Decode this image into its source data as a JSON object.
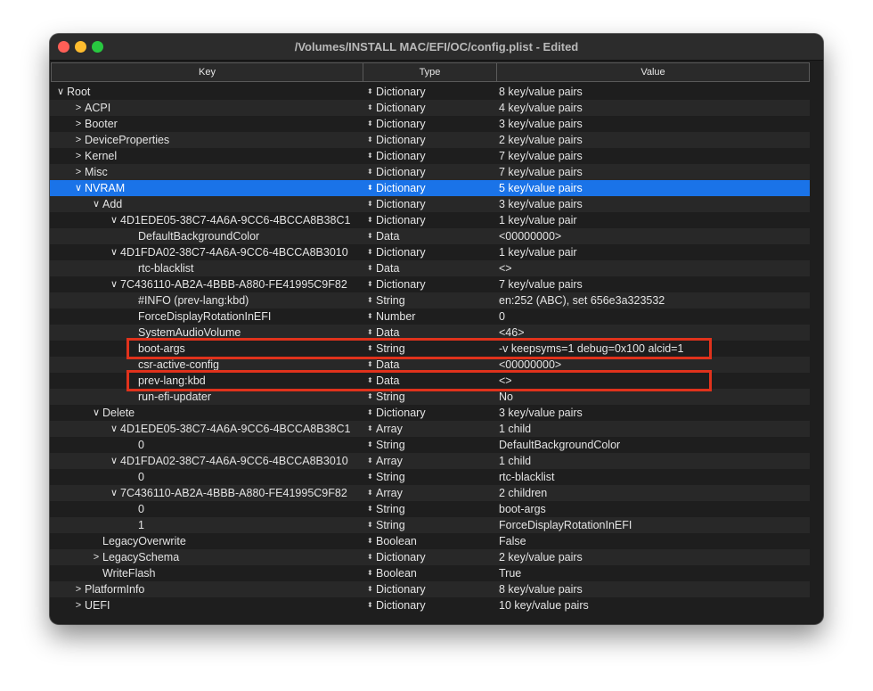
{
  "window": {
    "title": "/Volumes/INSTALL MAC/EFI/OC/config.plist - Edited"
  },
  "header": {
    "key": "Key",
    "type": "Type",
    "value": "Value"
  },
  "rows": [
    {
      "indent": 0,
      "disclosure": "open",
      "key": "Root",
      "type": "Dictionary",
      "value": "8 key/value pairs"
    },
    {
      "indent": 1,
      "disclosure": "closed",
      "key": "ACPI",
      "type": "Dictionary",
      "value": "4 key/value pairs"
    },
    {
      "indent": 1,
      "disclosure": "closed",
      "key": "Booter",
      "type": "Dictionary",
      "value": "3 key/value pairs"
    },
    {
      "indent": 1,
      "disclosure": "closed",
      "key": "DeviceProperties",
      "type": "Dictionary",
      "value": "2 key/value pairs"
    },
    {
      "indent": 1,
      "disclosure": "closed",
      "key": "Kernel",
      "type": "Dictionary",
      "value": "7 key/value pairs"
    },
    {
      "indent": 1,
      "disclosure": "closed",
      "key": "Misc",
      "type": "Dictionary",
      "value": "7 key/value pairs"
    },
    {
      "indent": 1,
      "disclosure": "open",
      "key": "NVRAM",
      "type": "Dictionary",
      "value": "5 key/value pairs",
      "selected": true
    },
    {
      "indent": 2,
      "disclosure": "open",
      "key": "Add",
      "type": "Dictionary",
      "value": "3 key/value pairs"
    },
    {
      "indent": 3,
      "disclosure": "open",
      "key": "4D1EDE05-38C7-4A6A-9CC6-4BCCA8B38C1",
      "type": "Dictionary",
      "value": "1 key/value pair"
    },
    {
      "indent": 4,
      "disclosure": "none",
      "key": "DefaultBackgroundColor",
      "type": "Data",
      "value": "<00000000>"
    },
    {
      "indent": 3,
      "disclosure": "open",
      "key": "4D1FDA02-38C7-4A6A-9CC6-4BCCA8B3010",
      "type": "Dictionary",
      "value": "1 key/value pair"
    },
    {
      "indent": 4,
      "disclosure": "none",
      "key": "rtc-blacklist",
      "type": "Data",
      "value": "<>"
    },
    {
      "indent": 3,
      "disclosure": "open",
      "key": "7C436110-AB2A-4BBB-A880-FE41995C9F82",
      "type": "Dictionary",
      "value": "7 key/value pairs"
    },
    {
      "indent": 4,
      "disclosure": "none",
      "key": "#INFO (prev-lang:kbd)",
      "type": "String",
      "value": "en:252 (ABC), set 656e3a323532"
    },
    {
      "indent": 4,
      "disclosure": "none",
      "key": "ForceDisplayRotationInEFI",
      "type": "Number",
      "value": "0"
    },
    {
      "indent": 4,
      "disclosure": "none",
      "key": "SystemAudioVolume",
      "type": "Data",
      "value": "<46>"
    },
    {
      "indent": 4,
      "disclosure": "none",
      "key": "boot-args",
      "type": "String",
      "value": "-v keepsyms=1 debug=0x100 alcid=1",
      "highlight": true
    },
    {
      "indent": 4,
      "disclosure": "none",
      "key": "csr-active-config",
      "type": "Data",
      "value": "<00000000>"
    },
    {
      "indent": 4,
      "disclosure": "none",
      "key": "prev-lang:kbd",
      "type": "Data",
      "value": "<>",
      "highlight": true
    },
    {
      "indent": 4,
      "disclosure": "none",
      "key": "run-efi-updater",
      "type": "String",
      "value": "No"
    },
    {
      "indent": 2,
      "disclosure": "open",
      "key": "Delete",
      "type": "Dictionary",
      "value": "3 key/value pairs"
    },
    {
      "indent": 3,
      "disclosure": "open",
      "key": "4D1EDE05-38C7-4A6A-9CC6-4BCCA8B38C1",
      "type": "Array",
      "value": "1 child"
    },
    {
      "indent": 4,
      "disclosure": "none",
      "key": "0",
      "type": "String",
      "value": "DefaultBackgroundColor"
    },
    {
      "indent": 3,
      "disclosure": "open",
      "key": "4D1FDA02-38C7-4A6A-9CC6-4BCCA8B3010",
      "type": "Array",
      "value": "1 child"
    },
    {
      "indent": 4,
      "disclosure": "none",
      "key": "0",
      "type": "String",
      "value": "rtc-blacklist"
    },
    {
      "indent": 3,
      "disclosure": "open",
      "key": "7C436110-AB2A-4BBB-A880-FE41995C9F82",
      "type": "Array",
      "value": "2 children"
    },
    {
      "indent": 4,
      "disclosure": "none",
      "key": "0",
      "type": "String",
      "value": "boot-args"
    },
    {
      "indent": 4,
      "disclosure": "none",
      "key": "1",
      "type": "String",
      "value": "ForceDisplayRotationInEFI"
    },
    {
      "indent": 2,
      "disclosure": "none",
      "key": "LegacyOverwrite",
      "type": "Boolean",
      "value": "False"
    },
    {
      "indent": 2,
      "disclosure": "closed",
      "key": "LegacySchema",
      "type": "Dictionary",
      "value": "2 key/value pairs"
    },
    {
      "indent": 2,
      "disclosure": "none",
      "key": "WriteFlash",
      "type": "Boolean",
      "value": "True"
    },
    {
      "indent": 1,
      "disclosure": "closed",
      "key": "PlatformInfo",
      "type": "Dictionary",
      "value": "8 key/value pairs"
    },
    {
      "indent": 1,
      "disclosure": "closed",
      "key": "UEFI",
      "type": "Dictionary",
      "value": "10 key/value pairs"
    }
  ],
  "colors": {
    "selection": "#1a73e8",
    "highlight_box": "#e0321c",
    "close": "#fe5f57",
    "minimize": "#febc2e",
    "zoom": "#28c840"
  }
}
